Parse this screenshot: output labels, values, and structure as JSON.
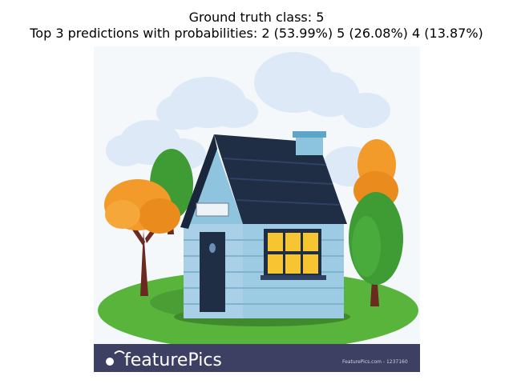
{
  "figure": {
    "title_line1": "Ground truth class: 5",
    "title_line2": "Top 3 predictions with probabilities: 2 (53.99%) 5 (26.08%) 4 (13.87%)"
  },
  "image": {
    "watermark_brand": "featurePics",
    "watermark_small": "FeaturePics.com - 1237160",
    "colors": {
      "sky": "#f4f8fb",
      "cloud": "#dde9f6",
      "roof": "#1f2d45",
      "wall": "#a9d0e6",
      "window": "#f7c531",
      "grass": "#58b43a",
      "tree_orange": "#f29a2a",
      "tree_green": "#3f9b34",
      "banner": "#3d3f63"
    }
  }
}
